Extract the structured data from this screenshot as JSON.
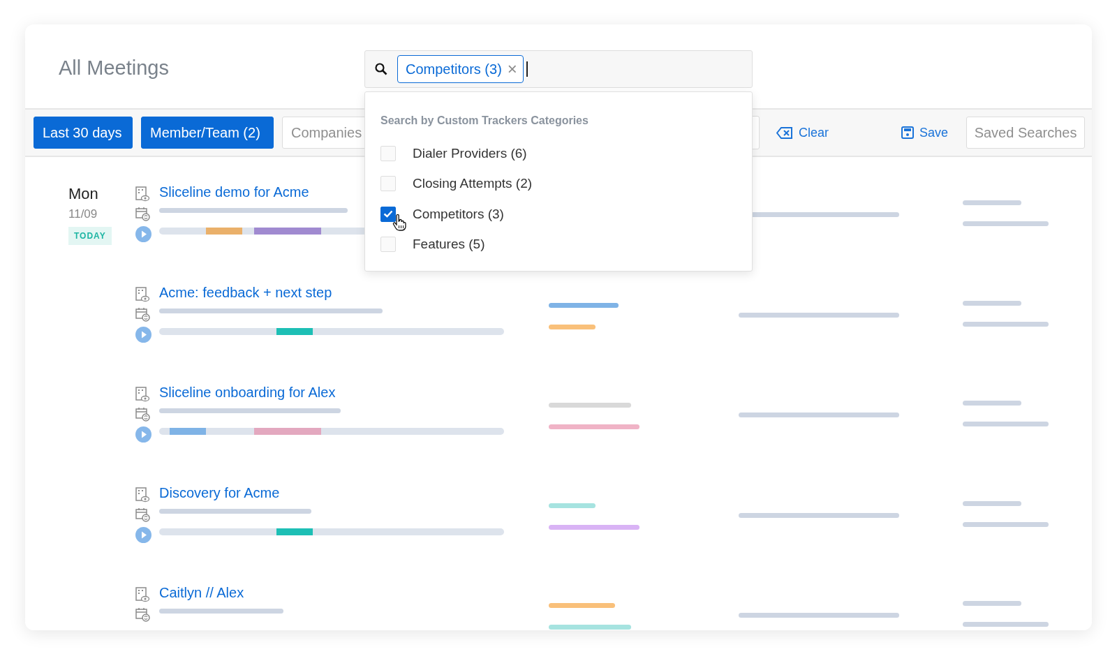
{
  "page": {
    "title": "All Meetings"
  },
  "search": {
    "chips": [
      {
        "label": "Competitors (3)",
        "remove": "×"
      }
    ]
  },
  "dropdown": {
    "heading": "Search by Custom Trackers Categories",
    "options": [
      {
        "label": "Dialer Providers (6)",
        "checked": false
      },
      {
        "label": "Closing Attempts (2)",
        "checked": false
      },
      {
        "label": "Competitors (3)",
        "checked": true
      },
      {
        "label": "Features (5)",
        "checked": false
      }
    ]
  },
  "filters": {
    "buttons": [
      {
        "label": "Last 30 days",
        "selected": true
      },
      {
        "label": "Member/Team (2)",
        "selected": true
      },
      {
        "label": "Companies",
        "selected": false
      }
    ],
    "clear": "Clear",
    "save": "Save",
    "saved_searches": "Saved Searches"
  },
  "meetings": [
    {
      "day": "Mon",
      "date": "11/09",
      "badge": "TODAY",
      "title": "Sliceline demo for Acme"
    },
    {
      "title": "Acme: feedback + next step",
      "tags": [
        {
          "color": "#7fb3e6"
        },
        {
          "color": "#f9c07a"
        }
      ]
    },
    {
      "title": "Sliceline onboarding for Alex",
      "tags": [
        {
          "color": "#d9d9d9"
        },
        {
          "color": "#f0b3c6"
        }
      ]
    },
    {
      "title": "Discovery for Acme",
      "tags": [
        {
          "color": "#a6e3e0"
        },
        {
          "color": "#d9b3f5"
        }
      ]
    },
    {
      "title": "Caitlyn // Alex",
      "tags": [
        {
          "color": "#f9c07a"
        },
        {
          "color": "#a6e3e0"
        }
      ]
    }
  ]
}
